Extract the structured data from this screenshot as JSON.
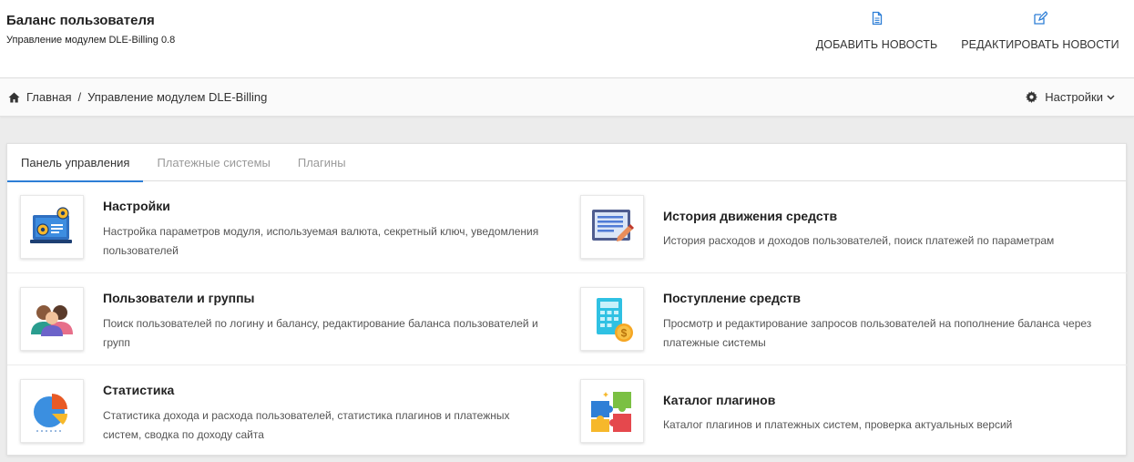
{
  "header": {
    "title": "Баланс пользователя",
    "subtitle": "Управление модулем DLE-Billing 0.8",
    "actions": [
      {
        "label": "ДОБАВИТЬ НОВОСТЬ",
        "icon": "document-icon"
      },
      {
        "label": "РЕДАКТИРОВАТЬ НОВОСТИ",
        "icon": "edit-icon"
      }
    ],
    "accent_color": "#2d7ed6"
  },
  "breadcrumb": {
    "home": "Главная",
    "separator": "/",
    "current": "Управление модулем DLE-Billing"
  },
  "settings_menu": {
    "label": "Настройки",
    "icon": "gear-icon"
  },
  "tabs": [
    {
      "label": "Панель управления",
      "active": true
    },
    {
      "label": "Платежные системы",
      "active": false
    },
    {
      "label": "Плагины",
      "active": false
    }
  ],
  "modules": [
    {
      "title": "Настройки",
      "description": "Настройка параметров модуля, используемая валюта, секретный ключ, уведомления пользователей",
      "icon": "laptop-gears-icon"
    },
    {
      "title": "История движения средств",
      "description": "История расходов и доходов пользователей, поиск платежей по параметрам",
      "icon": "document-pen-icon"
    },
    {
      "title": "Пользователи и группы",
      "description": "Поиск пользователей по логину и балансу, редактирование баланса пользователей и групп",
      "icon": "users-group-icon"
    },
    {
      "title": "Поступление средств",
      "description": "Просмотр и редактирование запросов пользователей на пополнение баланса через платежные системы",
      "icon": "calculator-coin-icon"
    },
    {
      "title": "Статистика",
      "description": "Статистика дохода и расхода пользователей, статистика плагинов и платежных систем, сводка по доходу сайта",
      "icon": "pie-chart-icon"
    },
    {
      "title": "Каталог плагинов",
      "description": "Каталог плагинов и платежных систем, проверка актуальных версий",
      "icon": "puzzle-icon"
    }
  ]
}
